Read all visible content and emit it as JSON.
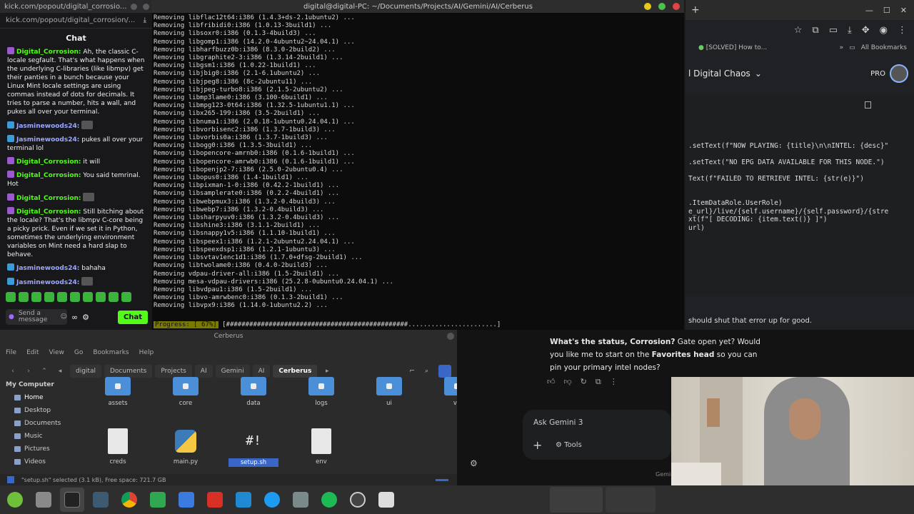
{
  "chat": {
    "window_title": "kick.com/popout/digital_corrosio...",
    "url": "kick.com/popout/digital_corrosion/...",
    "header": "Chat",
    "messages": [
      {
        "user": "Digital_Corrosion:",
        "text": "Ah, the classic C-locale segfault. That's what happens when the underlying C-libraries (like libmpv) get their panties in a bunch because your Linux Mint locale settings are using commas instead of dots for decimals. It tries to parse a number, hits a wall, and pukes all over your terminal.",
        "kind": "dc"
      },
      {
        "user": "Jasminewoods24:",
        "text": "",
        "kind": "jw",
        "emote": true
      },
      {
        "user": "Jasminewoods24:",
        "text": "pukes all over your terminal lol",
        "kind": "jw"
      },
      {
        "user": "Digital_Corrosion:",
        "text": "it will",
        "kind": "dc"
      },
      {
        "user": "Digital_Corrosion:",
        "text": "You said temrinal. Hot",
        "kind": "dc"
      },
      {
        "user": "Digital_Corrosion:",
        "text": "",
        "kind": "dc",
        "emote": true
      },
      {
        "user": "Digital_Corrosion:",
        "text": "Still bitching about the locale? That's the libmpv C-core being a picky prick. Even if we set it in Python, sometimes the underlying environment variables on Mint need a hard slap to behave.",
        "kind": "dc"
      },
      {
        "user": "Jasminewoods24:",
        "text": "bahaha",
        "kind": "jw"
      },
      {
        "user": "Jasminewoods24:",
        "text": "",
        "kind": "jw",
        "emote": true
      }
    ],
    "input_placeholder": "Send a message",
    "send_label": "Chat",
    "colors": {
      "accent": "#53fc18"
    }
  },
  "terminal": {
    "title": "digital@digital-PC: ~/Documents/Projects/AI/Gemini/AI/Cerberus",
    "lines": [
      "Removing libflac12t64:i386 (1.4.3+ds-2.1ubuntu2) ...",
      "Removing libfribidi0:i386 (1.0.13-3build1) ...",
      "Removing libsoxr0:i386 (0.1.3-4build3) ...",
      "Removing libgomp1:i386 (14.2.0-4ubuntu2~24.04.1) ...",
      "Removing libharfbuzz0b:i386 (8.3.0-2build2) ...",
      "Removing libgraphite2-3:i386 (1.3.14-2build1) ...",
      "Removing libgsm1:i386 (1.0.22-1build1) ...",
      "Removing libjbig0:i386 (2.1-6.1ubuntu2) ...",
      "Removing libjpeg8:i386 (8c-2ubuntu11) ...",
      "Removing libjpeg-turbo8:i386 (2.1.5-2ubuntu2) ...",
      "Removing libmp3lame0:i386 (3.100-6build1) ...",
      "Removing libmpg123-0t64:i386 (1.32.5-1ubuntu1.1) ...",
      "Removing libx265-199:i386 (3.5-2build1) ...",
      "Removing libnuma1:i386 (2.0.18-1ubuntu0.24.04.1) ...",
      "Removing libvorbisenc2:i386 (1.3.7-1build3) ...",
      "Removing libvorbis0a:i386 (1.3.7-1build3) ...",
      "Removing libogg0:i386 (1.3.5-3build1) ...",
      "Removing libopencore-amrnb0:i386 (0.1.6-1build1) ...",
      "Removing libopencore-amrwb0:i386 (0.1.6-1build1) ...",
      "Removing libopenjp2-7:i386 (2.5.0-2ubuntu0.4) ...",
      "Removing libopus0:i386 (1.4-1build1) ...",
      "Removing libpixman-1-0:i386 (0.42.2-1build1) ...",
      "Removing libsamplerate0:i386 (0.2.2-4build1) ...",
      "Removing libwebpmux3:i386 (1.3.2-0.4build3) ...",
      "Removing libwebp7:i386 (1.3.2-0.4build3) ...",
      "Removing libsharpyuv0:i386 (1.3.2-0.4build3) ...",
      "Removing libshine3:i386 (3.1.1-2build1) ...",
      "Removing libsnappy1v5:i386 (1.1.10-1build1) ...",
      "Removing libspeex1:i386 (1.2.1-2ubuntu2.24.04.1) ...",
      "Removing libspeexdsp1:i386 (1.2.1-1ubuntu3) ...",
      "Removing libsvtav1enc1d1:i386 (1.7.0+dfsg-2build1) ...",
      "Removing libtwolame0:i386 (0.4.0-2build3) ...",
      "Removing vdpau-driver-all:i386 (1.5-2build1) ...",
      "Removing mesa-vdpau-drivers:i386 (25.2.8-0ubuntu0.24.04.1) ...",
      "Removing libvdpau1:i386 (1.5-2build1) ...",
      "Removing libvo-amrwbenc0:i386 (0.1.3-2build1) ...",
      "Removing libvpx9:i386 (1.14.0-1ubuntu2.2) ..."
    ],
    "progress_label": "Progress: [ 67%]",
    "progress_percent": 67
  },
  "browser": {
    "bookmark_1": "[SOLVED] How to...",
    "bookmarks_all": "All Bookmarks",
    "gemini_title": "l Digital Chaos",
    "pro": "PRO",
    "code_lines": [
      ".setText(f\"NOW PLAYING: {title}\\n\\nINTEL: {desc}\"",
      "",
      ".setText(\"NO EPG DATA AVAILABLE FOR THIS NODE.\")",
      "",
      "Text(f\"FAILED TO RETRIEVE INTEL: {str(e)}\")",
      "",
      "",
      ".ItemDataRole.UserRole)",
      "e_url}/live/{self.username}/{self.password}/{stre",
      "xt(f\"[ DECODING: {item.text()} ]\")",
      "url)"
    ]
  },
  "gemini": {
    "note": "should shut that error up for good.",
    "question_lead": "What's the status, Corrosion?",
    "question_rest": " Gate open yet? Would you like me to start on the ",
    "question_bold": "Favorites head",
    "question_tail": " so you can pin your primary intel nodes?",
    "ask_placeholder": "Ask Gemini 3",
    "tools_label": "Tools",
    "footer": "Gemini"
  },
  "filemanager": {
    "title": "Cerberus",
    "menu": [
      "File",
      "Edit",
      "View",
      "Go",
      "Bookmarks",
      "Help"
    ],
    "breadcrumbs": [
      "digital",
      "Documents",
      "Projects",
      "AI",
      "Gemini",
      "AI",
      "Cerberus"
    ],
    "sidebar_header": "My Computer",
    "sidebar": [
      "Home",
      "Desktop",
      "Documents",
      "Music",
      "Pictures",
      "Videos"
    ],
    "folders": [
      "assets",
      "core",
      "data",
      "logs",
      "ui",
      "ve"
    ],
    "files": [
      "creds",
      "main.py",
      "setup.sh",
      "env"
    ],
    "status": "\"setup.sh\" selected (3.1 kB), Free space: 721.7 GB"
  }
}
